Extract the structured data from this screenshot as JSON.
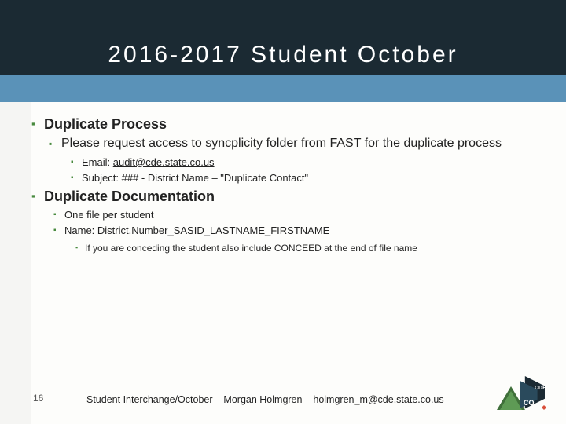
{
  "title": "2016-2017 Student October",
  "content": {
    "sections": [
      {
        "heading": "Duplicate Process",
        "items": [
          {
            "text": "Please request access to syncplicity folder from FAST for the duplicate process",
            "sub": [
              {
                "prefix": "Email: ",
                "link": "audit@cde.state.co.us"
              },
              {
                "text": "Subject: ### - District Name – \"Duplicate Contact\""
              }
            ]
          }
        ]
      },
      {
        "heading": "Duplicate Documentation",
        "items": [
          {
            "text": "One file per student"
          },
          {
            "text": "Name: District.Number_SASID_LASTNAME_FIRSTNAME",
            "sub4": [
              {
                "text": "If you are conceding the student also include CONCEED at the end of file name"
              }
            ]
          }
        ]
      }
    ]
  },
  "footer": {
    "page": "16",
    "line_prefix": "Student Interchange/October – Morgan Holmgren – ",
    "email": "holmgren_m@cde.state.co.us"
  },
  "logo": {
    "name": "cde-colorado-logo"
  }
}
